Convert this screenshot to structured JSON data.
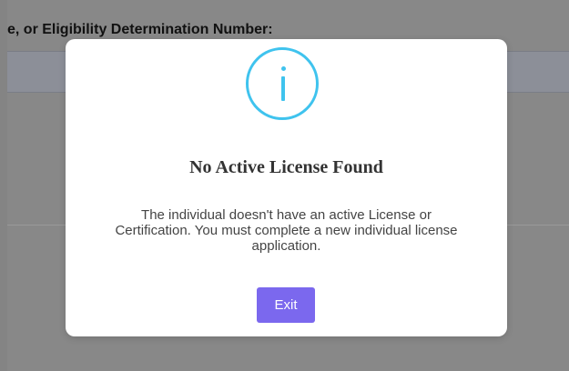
{
  "background": {
    "heading": "e, or Eligibility Determination Number:"
  },
  "modal": {
    "icon": "info-icon",
    "icon_color": "#3fc3ee",
    "title": "No Active License Found",
    "message": "The individual doesn't have an active License or Certification. You must complete a new individual license application.",
    "exit_label": "Exit",
    "exit_color": "#7b68ee"
  }
}
